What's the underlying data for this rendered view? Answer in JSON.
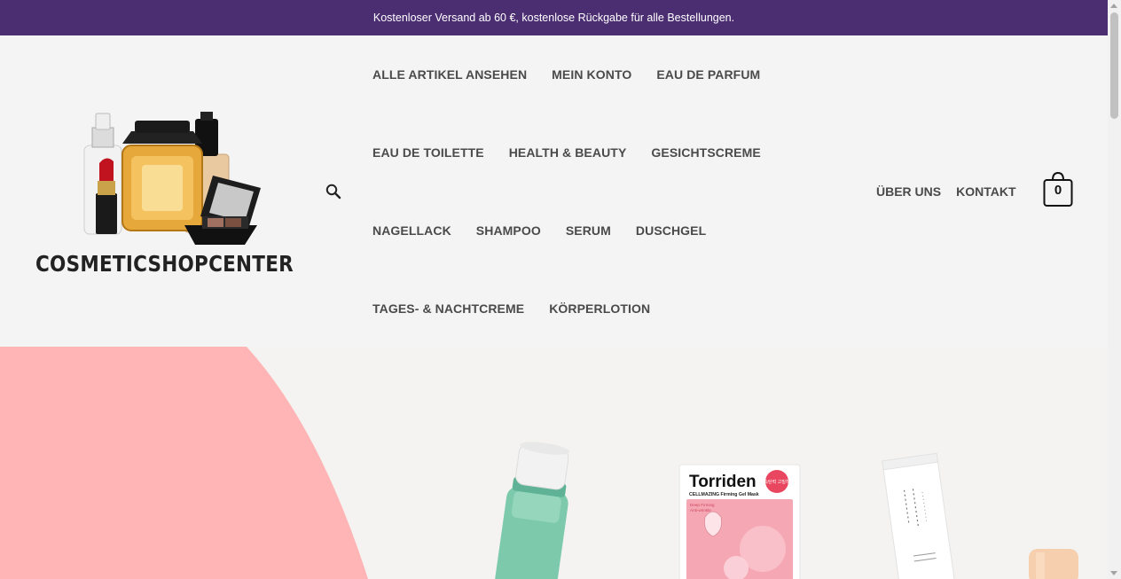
{
  "topbar": {
    "text": "Kostenloser Versand ab 60 €, kostenlose Rückgabe für alle Bestellungen."
  },
  "logo": {
    "text": "COSMETICSHOPCENTER"
  },
  "nav": {
    "row1": [
      "ALLE ARTIKEL ANSEHEN",
      "MEIN KONTO",
      "EAU DE PARFUM"
    ],
    "row2": [
      "EAU DE TOILETTE",
      "HEALTH & BEAUTY",
      "GESICHTSCREME"
    ],
    "row3": [
      "NAGELLACK",
      "SHAMPOO",
      "SERUM",
      "DUSCHGEL"
    ],
    "row4": [
      "TAGES- & NACHTCREME",
      "KÖRPERLOTION"
    ]
  },
  "right_nav": {
    "about": "ÜBER UNS",
    "contact": "KONTAKT"
  },
  "cart": {
    "count": "0"
  },
  "hero": {
    "products": {
      "mask_brand": "Torriden",
      "mask_line": "CELLMAZING Firming Gel Mask",
      "mask_sub1": "Deep Firming",
      "mask_sub2": "Anti-wrinkle",
      "mask_badge": "속탄력 고밀착"
    }
  },
  "colors": {
    "topbar": "#4b2d72",
    "header_bg": "#f4f4f4",
    "nav_text": "#4a4a4a",
    "hero_pink": "#ffb5b5"
  }
}
